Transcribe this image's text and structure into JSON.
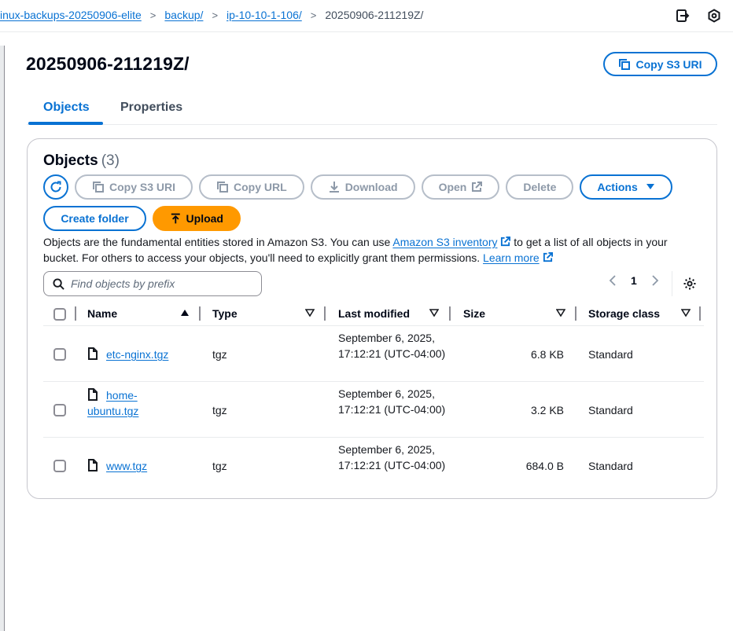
{
  "breadcrumb": {
    "items": [
      "inux-backups-20250906-elite",
      "backup/",
      "ip-10-10-1-106/"
    ],
    "current": "20250906-211219Z/",
    "separator": ">"
  },
  "header": {
    "icons": [
      "export-icon",
      "hexagon-settings-icon"
    ]
  },
  "page": {
    "title": "20250906-211219Z/",
    "copy_s3_uri_label": "Copy S3 URI"
  },
  "tabs": [
    {
      "label": "Objects",
      "active": true
    },
    {
      "label": "Properties",
      "active": false
    }
  ],
  "objects_panel": {
    "heading": "Objects",
    "count": "(3)",
    "toolbar": {
      "copy_s3_uri": "Copy S3 URI",
      "copy_url": "Copy URL",
      "download": "Download",
      "open": "Open",
      "delete": "Delete",
      "actions": "Actions",
      "create_folder": "Create folder",
      "upload": "Upload"
    },
    "description": {
      "part1": "Objects are the fundamental entities stored in Amazon S3. You can use ",
      "link1": "Amazon S3 inventory",
      "part2": " to get a list of all objects in your bucket. For others to access your objects, you'll need to explicitly grant them permissions. ",
      "link2": "Learn more"
    },
    "search": {
      "placeholder": "Find objects by prefix",
      "value": ""
    },
    "pagination": {
      "current_page": "1"
    },
    "columns": [
      "Name",
      "Type",
      "Last modified",
      "Size",
      "Storage class"
    ],
    "rows": [
      {
        "name": "etc-nginx.tgz",
        "type": "tgz",
        "last_modified": "September 6, 2025, 17:12:21 (UTC-04:00)",
        "size": "6.8 KB",
        "storage_class": "Standard"
      },
      {
        "name": "home-ubuntu.tgz",
        "type": "tgz",
        "last_modified": "September 6, 2025, 17:12:21 (UTC-04:00)",
        "size": "3.2 KB",
        "storage_class": "Standard"
      },
      {
        "name": "www.tgz",
        "type": "tgz",
        "last_modified": "September 6, 2025, 17:12:21 (UTC-04:00)",
        "size": "684.0 B",
        "storage_class": "Standard"
      }
    ]
  },
  "colors": {
    "link": "#0972d3",
    "upload_button": "#ff9900",
    "disabled": "#8d99a8",
    "border": "#c6c6cd"
  }
}
